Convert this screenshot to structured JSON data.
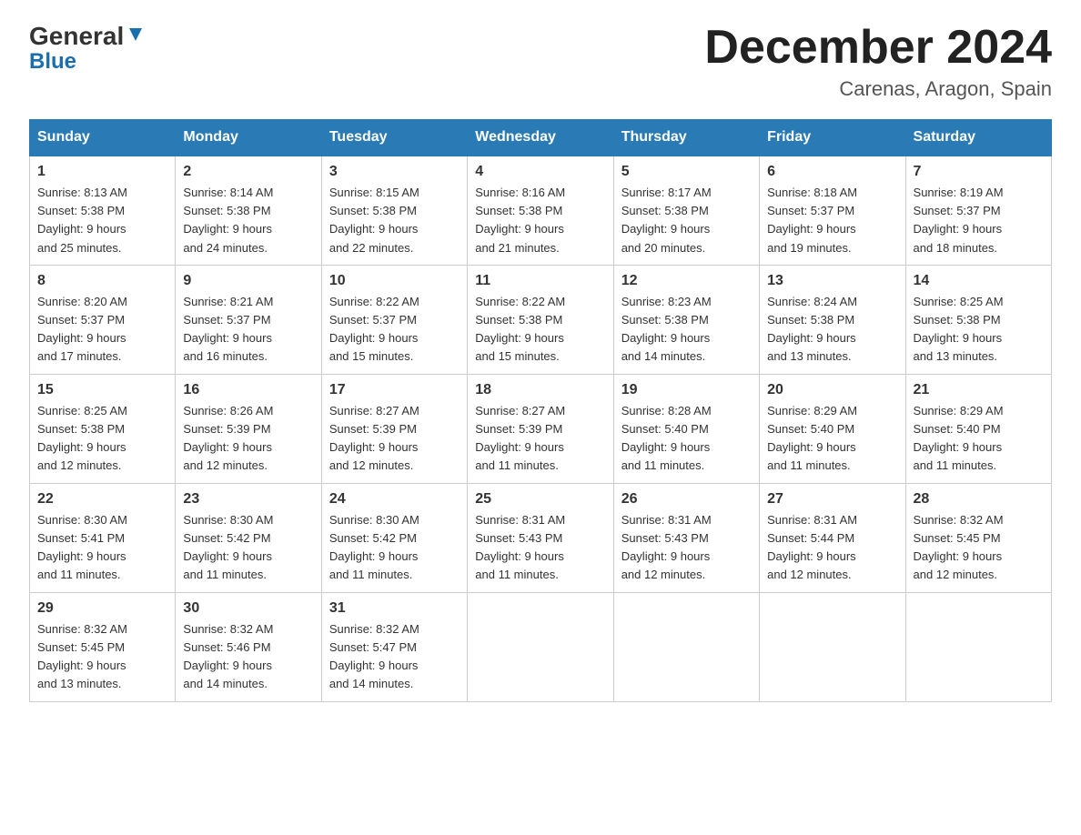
{
  "header": {
    "logo_general": "General",
    "logo_blue": "Blue",
    "month_title": "December 2024",
    "location": "Carenas, Aragon, Spain"
  },
  "days_of_week": [
    "Sunday",
    "Monday",
    "Tuesday",
    "Wednesday",
    "Thursday",
    "Friday",
    "Saturday"
  ],
  "weeks": [
    [
      {
        "day": "1",
        "sunrise": "Sunrise: 8:13 AM",
        "sunset": "Sunset: 5:38 PM",
        "daylight": "Daylight: 9 hours",
        "daylight2": "and 25 minutes."
      },
      {
        "day": "2",
        "sunrise": "Sunrise: 8:14 AM",
        "sunset": "Sunset: 5:38 PM",
        "daylight": "Daylight: 9 hours",
        "daylight2": "and 24 minutes."
      },
      {
        "day": "3",
        "sunrise": "Sunrise: 8:15 AM",
        "sunset": "Sunset: 5:38 PM",
        "daylight": "Daylight: 9 hours",
        "daylight2": "and 22 minutes."
      },
      {
        "day": "4",
        "sunrise": "Sunrise: 8:16 AM",
        "sunset": "Sunset: 5:38 PM",
        "daylight": "Daylight: 9 hours",
        "daylight2": "and 21 minutes."
      },
      {
        "day": "5",
        "sunrise": "Sunrise: 8:17 AM",
        "sunset": "Sunset: 5:38 PM",
        "daylight": "Daylight: 9 hours",
        "daylight2": "and 20 minutes."
      },
      {
        "day": "6",
        "sunrise": "Sunrise: 8:18 AM",
        "sunset": "Sunset: 5:37 PM",
        "daylight": "Daylight: 9 hours",
        "daylight2": "and 19 minutes."
      },
      {
        "day": "7",
        "sunrise": "Sunrise: 8:19 AM",
        "sunset": "Sunset: 5:37 PM",
        "daylight": "Daylight: 9 hours",
        "daylight2": "and 18 minutes."
      }
    ],
    [
      {
        "day": "8",
        "sunrise": "Sunrise: 8:20 AM",
        "sunset": "Sunset: 5:37 PM",
        "daylight": "Daylight: 9 hours",
        "daylight2": "and 17 minutes."
      },
      {
        "day": "9",
        "sunrise": "Sunrise: 8:21 AM",
        "sunset": "Sunset: 5:37 PM",
        "daylight": "Daylight: 9 hours",
        "daylight2": "and 16 minutes."
      },
      {
        "day": "10",
        "sunrise": "Sunrise: 8:22 AM",
        "sunset": "Sunset: 5:37 PM",
        "daylight": "Daylight: 9 hours",
        "daylight2": "and 15 minutes."
      },
      {
        "day": "11",
        "sunrise": "Sunrise: 8:22 AM",
        "sunset": "Sunset: 5:38 PM",
        "daylight": "Daylight: 9 hours",
        "daylight2": "and 15 minutes."
      },
      {
        "day": "12",
        "sunrise": "Sunrise: 8:23 AM",
        "sunset": "Sunset: 5:38 PM",
        "daylight": "Daylight: 9 hours",
        "daylight2": "and 14 minutes."
      },
      {
        "day": "13",
        "sunrise": "Sunrise: 8:24 AM",
        "sunset": "Sunset: 5:38 PM",
        "daylight": "Daylight: 9 hours",
        "daylight2": "and 13 minutes."
      },
      {
        "day": "14",
        "sunrise": "Sunrise: 8:25 AM",
        "sunset": "Sunset: 5:38 PM",
        "daylight": "Daylight: 9 hours",
        "daylight2": "and 13 minutes."
      }
    ],
    [
      {
        "day": "15",
        "sunrise": "Sunrise: 8:25 AM",
        "sunset": "Sunset: 5:38 PM",
        "daylight": "Daylight: 9 hours",
        "daylight2": "and 12 minutes."
      },
      {
        "day": "16",
        "sunrise": "Sunrise: 8:26 AM",
        "sunset": "Sunset: 5:39 PM",
        "daylight": "Daylight: 9 hours",
        "daylight2": "and 12 minutes."
      },
      {
        "day": "17",
        "sunrise": "Sunrise: 8:27 AM",
        "sunset": "Sunset: 5:39 PM",
        "daylight": "Daylight: 9 hours",
        "daylight2": "and 12 minutes."
      },
      {
        "day": "18",
        "sunrise": "Sunrise: 8:27 AM",
        "sunset": "Sunset: 5:39 PM",
        "daylight": "Daylight: 9 hours",
        "daylight2": "and 11 minutes."
      },
      {
        "day": "19",
        "sunrise": "Sunrise: 8:28 AM",
        "sunset": "Sunset: 5:40 PM",
        "daylight": "Daylight: 9 hours",
        "daylight2": "and 11 minutes."
      },
      {
        "day": "20",
        "sunrise": "Sunrise: 8:29 AM",
        "sunset": "Sunset: 5:40 PM",
        "daylight": "Daylight: 9 hours",
        "daylight2": "and 11 minutes."
      },
      {
        "day": "21",
        "sunrise": "Sunrise: 8:29 AM",
        "sunset": "Sunset: 5:40 PM",
        "daylight": "Daylight: 9 hours",
        "daylight2": "and 11 minutes."
      }
    ],
    [
      {
        "day": "22",
        "sunrise": "Sunrise: 8:30 AM",
        "sunset": "Sunset: 5:41 PM",
        "daylight": "Daylight: 9 hours",
        "daylight2": "and 11 minutes."
      },
      {
        "day": "23",
        "sunrise": "Sunrise: 8:30 AM",
        "sunset": "Sunset: 5:42 PM",
        "daylight": "Daylight: 9 hours",
        "daylight2": "and 11 minutes."
      },
      {
        "day": "24",
        "sunrise": "Sunrise: 8:30 AM",
        "sunset": "Sunset: 5:42 PM",
        "daylight": "Daylight: 9 hours",
        "daylight2": "and 11 minutes."
      },
      {
        "day": "25",
        "sunrise": "Sunrise: 8:31 AM",
        "sunset": "Sunset: 5:43 PM",
        "daylight": "Daylight: 9 hours",
        "daylight2": "and 11 minutes."
      },
      {
        "day": "26",
        "sunrise": "Sunrise: 8:31 AM",
        "sunset": "Sunset: 5:43 PM",
        "daylight": "Daylight: 9 hours",
        "daylight2": "and 12 minutes."
      },
      {
        "day": "27",
        "sunrise": "Sunrise: 8:31 AM",
        "sunset": "Sunset: 5:44 PM",
        "daylight": "Daylight: 9 hours",
        "daylight2": "and 12 minutes."
      },
      {
        "day": "28",
        "sunrise": "Sunrise: 8:32 AM",
        "sunset": "Sunset: 5:45 PM",
        "daylight": "Daylight: 9 hours",
        "daylight2": "and 12 minutes."
      }
    ],
    [
      {
        "day": "29",
        "sunrise": "Sunrise: 8:32 AM",
        "sunset": "Sunset: 5:45 PM",
        "daylight": "Daylight: 9 hours",
        "daylight2": "and 13 minutes."
      },
      {
        "day": "30",
        "sunrise": "Sunrise: 8:32 AM",
        "sunset": "Sunset: 5:46 PM",
        "daylight": "Daylight: 9 hours",
        "daylight2": "and 14 minutes."
      },
      {
        "day": "31",
        "sunrise": "Sunrise: 8:32 AM",
        "sunset": "Sunset: 5:47 PM",
        "daylight": "Daylight: 9 hours",
        "daylight2": "and 14 minutes."
      },
      null,
      null,
      null,
      null
    ]
  ]
}
